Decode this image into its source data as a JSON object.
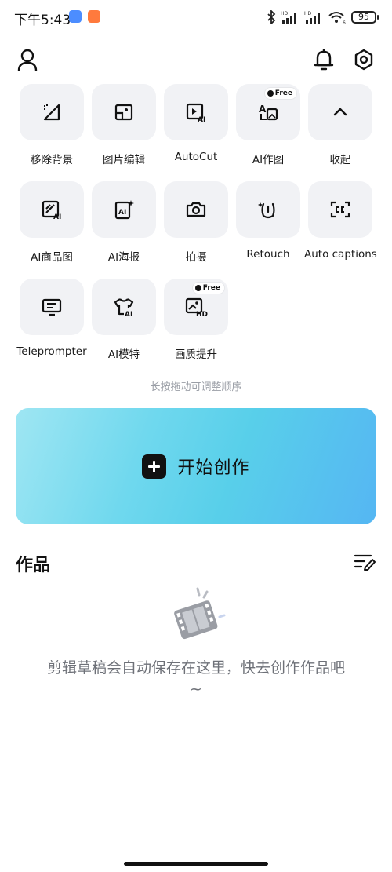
{
  "status_bar": {
    "time": "下午5:43",
    "battery": "95",
    "signal_label_1": "HD",
    "signal_label_2": "HD",
    "wifi_label": "6"
  },
  "header": {
    "profile_icon": "user-icon",
    "notifications_icon": "bell-icon",
    "settings_icon": "gear-icon"
  },
  "tools": [
    {
      "label": "移除背景",
      "icon": "remove-background-icon",
      "free": false
    },
    {
      "label": "图片编辑",
      "icon": "image-edit-icon",
      "free": false
    },
    {
      "label": "AutoCut",
      "icon": "autocut-ai-icon",
      "free": false
    },
    {
      "label": "AI作图",
      "icon": "ai-draw-icon",
      "free": true
    },
    {
      "label": "收起",
      "icon": "chevron-up-icon",
      "free": false
    },
    {
      "label": "AI商品图",
      "icon": "ai-product-image-icon",
      "free": false
    },
    {
      "label": "AI海报",
      "icon": "ai-poster-icon",
      "free": false
    },
    {
      "label": "拍摄",
      "icon": "camera-icon",
      "free": false
    },
    {
      "label": "Retouch",
      "icon": "retouch-face-icon",
      "free": false
    },
    {
      "label": "Auto captions",
      "icon": "captions-icon",
      "free": false
    },
    {
      "label": "Teleprompter",
      "icon": "teleprompter-icon",
      "free": false
    },
    {
      "label": "AI模特",
      "icon": "ai-model-shirt-icon",
      "free": false
    },
    {
      "label": "画质提升",
      "icon": "hd-enhance-icon",
      "free": true
    }
  ],
  "free_badge": "Free",
  "hint": "长按拖动可调整顺序",
  "create_button": {
    "label": "开始创作"
  },
  "works": {
    "title": "作品",
    "empty_message": "剪辑草稿会自动保存在这里，快去创作作品吧~"
  }
}
